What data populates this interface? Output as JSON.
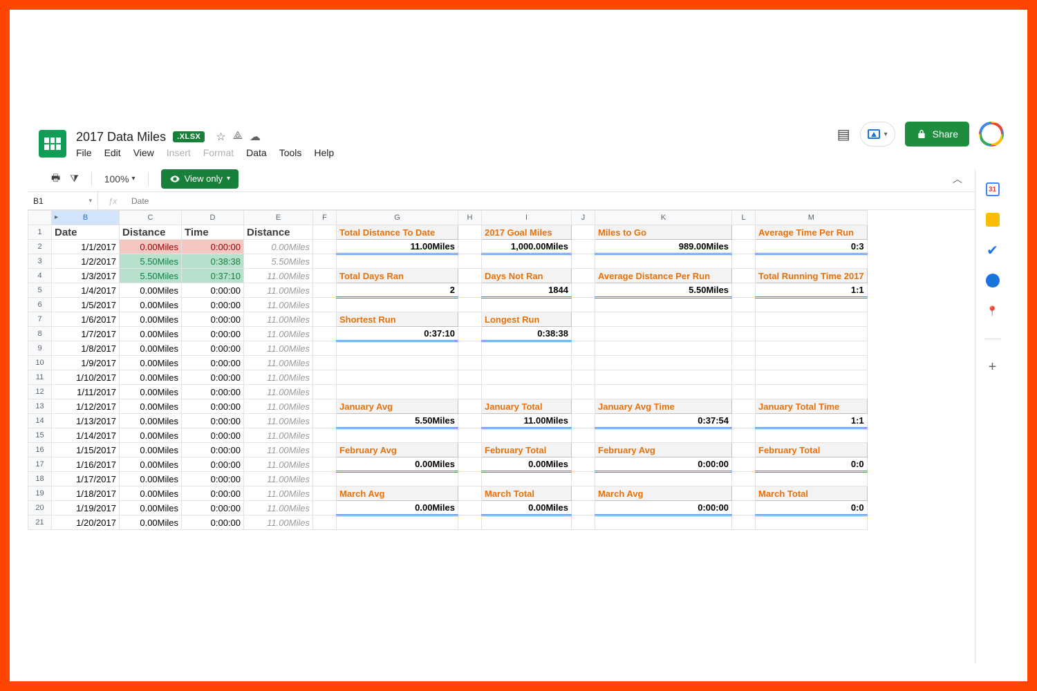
{
  "header": {
    "title": "2017 Data Miles",
    "badge": ".XLSX",
    "menus": [
      "File",
      "Edit",
      "View",
      "Insert",
      "Format",
      "Data",
      "Tools",
      "Help"
    ],
    "share": "Share"
  },
  "toolbar": {
    "zoom": "100%",
    "viewonly": "View only"
  },
  "fxbar": {
    "cell": "B1",
    "value": "Date"
  },
  "cols": [
    "B",
    "C",
    "D",
    "E",
    "F",
    "G",
    "H",
    "I",
    "J",
    "K",
    "L",
    "M"
  ],
  "side": {
    "cal": "31"
  },
  "row1": {
    "b": "Date",
    "c": "Distance",
    "d": "Time",
    "e": "Distance"
  },
  "log": [
    {
      "n": 2,
      "date": "1/1/2017",
      "dist": "0.00Miles",
      "time": "0:00:00",
      "e": "0.00Miles",
      "hl": "red"
    },
    {
      "n": 3,
      "date": "1/2/2017",
      "dist": "5.50Miles",
      "time": "0:38:38",
      "e": "5.50Miles",
      "hl": "grn"
    },
    {
      "n": 4,
      "date": "1/3/2017",
      "dist": "5.50Miles",
      "time": "0:37:10",
      "e": "11.00Miles",
      "hl": "grn"
    },
    {
      "n": 5,
      "date": "1/4/2017",
      "dist": "0.00Miles",
      "time": "0:00:00",
      "e": "11.00Miles"
    },
    {
      "n": 6,
      "date": "1/5/2017",
      "dist": "0.00Miles",
      "time": "0:00:00",
      "e": "11.00Miles"
    },
    {
      "n": 7,
      "date": "1/6/2017",
      "dist": "0.00Miles",
      "time": "0:00:00",
      "e": "11.00Miles"
    },
    {
      "n": 8,
      "date": "1/7/2017",
      "dist": "0.00Miles",
      "time": "0:00:00",
      "e": "11.00Miles"
    },
    {
      "n": 9,
      "date": "1/8/2017",
      "dist": "0.00Miles",
      "time": "0:00:00",
      "e": "11.00Miles"
    },
    {
      "n": 10,
      "date": "1/9/2017",
      "dist": "0.00Miles",
      "time": "0:00:00",
      "e": "11.00Miles"
    },
    {
      "n": 11,
      "date": "1/10/2017",
      "dist": "0.00Miles",
      "time": "0:00:00",
      "e": "11.00Miles"
    },
    {
      "n": 12,
      "date": "1/11/2017",
      "dist": "0.00Miles",
      "time": "0:00:00",
      "e": "11.00Miles"
    },
    {
      "n": 13,
      "date": "1/12/2017",
      "dist": "0.00Miles",
      "time": "0:00:00",
      "e": "11.00Miles"
    },
    {
      "n": 14,
      "date": "1/13/2017",
      "dist": "0.00Miles",
      "time": "0:00:00",
      "e": "11.00Miles"
    },
    {
      "n": 15,
      "date": "1/14/2017",
      "dist": "0.00Miles",
      "time": "0:00:00",
      "e": "11.00Miles"
    },
    {
      "n": 16,
      "date": "1/15/2017",
      "dist": "0.00Miles",
      "time": "0:00:00",
      "e": "11.00Miles"
    },
    {
      "n": 17,
      "date": "1/16/2017",
      "dist": "0.00Miles",
      "time": "0:00:00",
      "e": "11.00Miles"
    },
    {
      "n": 18,
      "date": "1/17/2017",
      "dist": "0.00Miles",
      "time": "0:00:00",
      "e": "11.00Miles"
    },
    {
      "n": 19,
      "date": "1/18/2017",
      "dist": "0.00Miles",
      "time": "0:00:00",
      "e": "11.00Miles"
    },
    {
      "n": 20,
      "date": "1/19/2017",
      "dist": "0.00Miles",
      "time": "0:00:00",
      "e": "11.00Miles"
    },
    {
      "n": 21,
      "date": "1/20/2017",
      "dist": "0.00Miles",
      "time": "0:00:00",
      "e": "11.00Miles"
    }
  ],
  "stats": {
    "1": {
      "g": {
        "l": "Total Distance To Date"
      },
      "i": {
        "l": "2017 Goal Miles"
      },
      "k": {
        "l": "Miles to Go"
      },
      "m": {
        "l": "Average Time Per Run"
      }
    },
    "2": {
      "g": {
        "v": "11.00Miles"
      },
      "i": {
        "v": "1,000.00Miles"
      },
      "k": {
        "v": "989.00Miles"
      },
      "m": {
        "v": "0:3"
      }
    },
    "4": {
      "g": {
        "l": "Total Days Ran"
      },
      "i": {
        "l": "Days Not Ran"
      },
      "k": {
        "l": "Average Distance Per Run"
      },
      "m": {
        "l": "Total Running Time 2017"
      }
    },
    "5": {
      "g": {
        "v": "2"
      },
      "i": {
        "v": "1844"
      },
      "k": {
        "v": "5.50Miles"
      },
      "m": {
        "v": "1:1"
      }
    },
    "7": {
      "g": {
        "l": "Shortest Run"
      },
      "i": {
        "l": "Longest Run"
      }
    },
    "8": {
      "g": {
        "v": "0:37:10"
      },
      "i": {
        "v": "0:38:38"
      }
    },
    "13": {
      "g": {
        "l": "January Avg"
      },
      "i": {
        "l": "January Total"
      },
      "k": {
        "l": "January Avg Time"
      },
      "m": {
        "l": "January Total Time"
      }
    },
    "14": {
      "g": {
        "v": "5.50Miles"
      },
      "i": {
        "v": "11.00Miles"
      },
      "k": {
        "v": "0:37:54"
      },
      "m": {
        "v": "1:1"
      }
    },
    "16": {
      "g": {
        "l": "February Avg"
      },
      "i": {
        "l": "February Total"
      },
      "k": {
        "l": "February Avg"
      },
      "m": {
        "l": "February Total"
      }
    },
    "17": {
      "g": {
        "v": "0.00Miles"
      },
      "i": {
        "v": "0.00Miles"
      },
      "k": {
        "v": "0:00:00"
      },
      "m": {
        "v": "0:0"
      }
    },
    "19": {
      "g": {
        "l": "March Avg"
      },
      "i": {
        "l": "March Total"
      },
      "k": {
        "l": "March Avg"
      },
      "m": {
        "l": "March Total"
      }
    },
    "20": {
      "g": {
        "v": "0.00Miles"
      },
      "i": {
        "v": "0.00Miles"
      },
      "k": {
        "v": "0:00:00"
      },
      "m": {
        "v": "0:0"
      }
    }
  }
}
